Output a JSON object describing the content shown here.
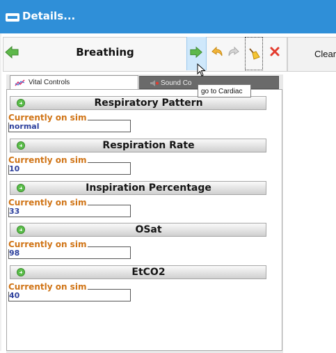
{
  "window": {
    "title": "Details..."
  },
  "toolbar": {
    "screen_label": "Breathing",
    "clear_label": "Clear",
    "icons": [
      "back-arrow-icon",
      "forward-arrow-icon",
      "undo-icon",
      "redo-icon",
      "broom-icon",
      "close-icon"
    ]
  },
  "tabs": [
    {
      "label": "Vital Controls",
      "active": true
    },
    {
      "label": "Sound Co",
      "active": false
    }
  ],
  "tooltip": "go to Cardiac",
  "current_label": "Currently on sim",
  "sections": [
    {
      "title": "Respiratory Pattern",
      "value": "normal"
    },
    {
      "title": "Respiration Rate",
      "value": "10"
    },
    {
      "title": "Inspiration Percentage",
      "value": "33"
    },
    {
      "title": "OSat",
      "value": "98"
    },
    {
      "title": "EtCO2",
      "value": "40"
    }
  ],
  "colors": {
    "titlebar": "#2f8fd8",
    "current_label": "#d07416",
    "current_value": "#2c3f9c"
  }
}
